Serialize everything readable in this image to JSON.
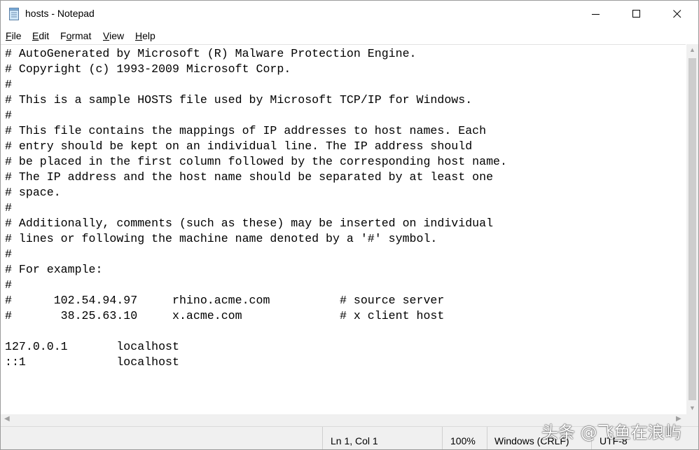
{
  "window": {
    "title": "hosts - Notepad",
    "icon": "notepad-icon"
  },
  "menu": {
    "file": {
      "u": "F",
      "rest": "ile"
    },
    "edit": {
      "u": "E",
      "rest": "dit"
    },
    "format": {
      "pre": "F",
      "u": "o",
      "rest": "rmat"
    },
    "view": {
      "u": "V",
      "rest": "iew"
    },
    "help": {
      "u": "H",
      "rest": "elp"
    }
  },
  "editor": {
    "content": "# AutoGenerated by Microsoft (R) Malware Protection Engine.\n# Copyright (c) 1993-2009 Microsoft Corp.\n#\n# This is a sample HOSTS file used by Microsoft TCP/IP for Windows.\n#\n# This file contains the mappings of IP addresses to host names. Each\n# entry should be kept on an individual line. The IP address should\n# be placed in the first column followed by the corresponding host name.\n# The IP address and the host name should be separated by at least one\n# space.\n#\n# Additionally, comments (such as these) may be inserted on individual\n# lines or following the machine name denoted by a '#' symbol.\n#\n# For example:\n#\n#      102.54.94.97     rhino.acme.com          # source server\n#       38.25.63.10     x.acme.com              # x client host\n\n127.0.0.1       localhost\n::1             localhost"
  },
  "status": {
    "position": "Ln 1, Col 1",
    "zoom": "100%",
    "line_ending": "Windows (CRLF)",
    "encoding": "UTF-8"
  },
  "watermark": "头条 @飞鱼在浪屿"
}
